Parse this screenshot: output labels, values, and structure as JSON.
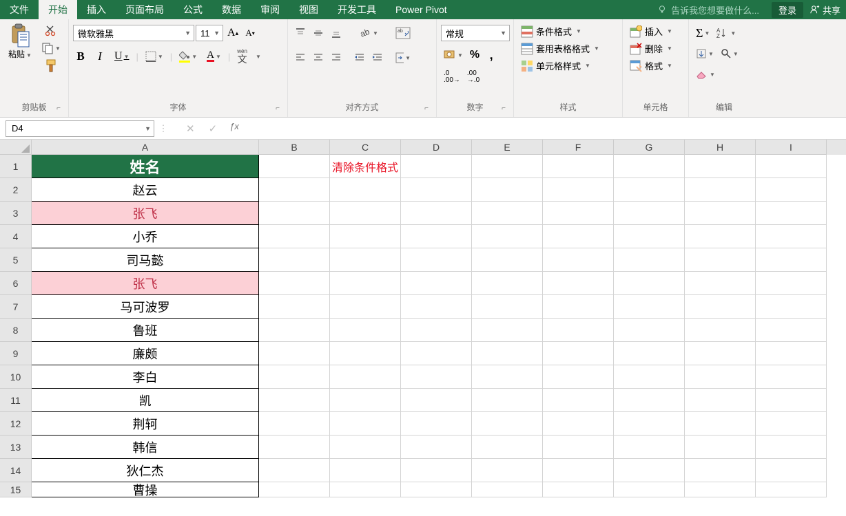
{
  "tabs": [
    "文件",
    "开始",
    "插入",
    "页面布局",
    "公式",
    "数据",
    "审阅",
    "视图",
    "开发工具",
    "Power Pivot"
  ],
  "active_tab_index": 1,
  "tell_me": "告诉我您想要做什么...",
  "login": "登录",
  "share": "共享",
  "ribbon": {
    "clipboard": {
      "paste": "粘贴",
      "label": "剪贴板"
    },
    "font": {
      "label": "字体",
      "name": "微软雅黑",
      "size": "11",
      "wen_text": "wén",
      "wen_char": "文"
    },
    "align": {
      "label": "对齐方式"
    },
    "number": {
      "label": "数字",
      "format": "常规"
    },
    "styles": {
      "label": "样式",
      "conditional": "条件格式",
      "table": "套用表格格式",
      "cell": "单元格样式"
    },
    "cells": {
      "label": "单元格",
      "insert": "插入",
      "delete": "删除",
      "format": "格式"
    },
    "editing": {
      "label": "编辑"
    }
  },
  "name_box": "D4",
  "columns": [
    "A",
    "B",
    "C",
    "D",
    "E",
    "F",
    "G",
    "H",
    "I"
  ],
  "rows": [
    {
      "n": 1,
      "a": "姓名",
      "header": true
    },
    {
      "n": 2,
      "a": "赵云"
    },
    {
      "n": 3,
      "a": "张飞",
      "hl": true
    },
    {
      "n": 4,
      "a": "小乔"
    },
    {
      "n": 5,
      "a": "司马懿"
    },
    {
      "n": 6,
      "a": "张飞",
      "hl": true
    },
    {
      "n": 7,
      "a": "马可波罗"
    },
    {
      "n": 8,
      "a": "鲁班"
    },
    {
      "n": 9,
      "a": "廉颇"
    },
    {
      "n": 10,
      "a": "李白"
    },
    {
      "n": 11,
      "a": "凯"
    },
    {
      "n": 12,
      "a": "荆轲"
    },
    {
      "n": 13,
      "a": "韩信"
    },
    {
      "n": 14,
      "a": "狄仁杰"
    },
    {
      "n": 15,
      "a": "曹操",
      "partial": true
    }
  ],
  "c1_text": "清除条件格式"
}
